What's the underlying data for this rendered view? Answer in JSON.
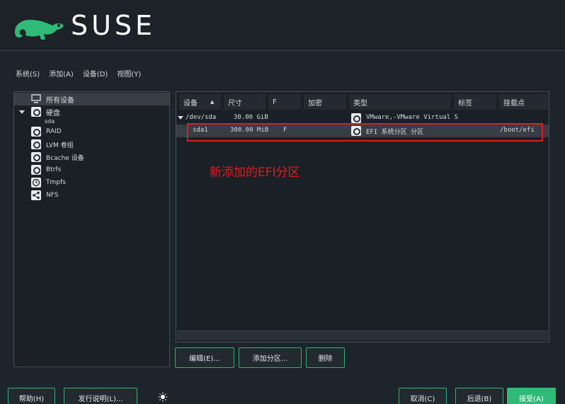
{
  "brand": {
    "name": "SUSE",
    "accent": "#30ba78",
    "annotation_color": "#e01b1b"
  },
  "menu": {
    "items": [
      "系统(S)",
      "添加(A)",
      "设备(D)",
      "视图(Y)"
    ]
  },
  "tree": {
    "items": [
      {
        "label": "所有设备",
        "icon": "monitor-icon",
        "selected": true
      },
      {
        "label": "硬盘",
        "icon": "hard-disk-icon",
        "expanded": true
      },
      {
        "label": "sda",
        "icon": ""
      },
      {
        "label": "RAID",
        "icon": "raid-icon"
      },
      {
        "label": "LVM 卷组",
        "icon": "lvm-icon"
      },
      {
        "label": "Bcache 设备",
        "icon": "bcache-icon"
      },
      {
        "label": "Btrfs",
        "icon": "btrfs-icon"
      },
      {
        "label": "Tmpfs",
        "icon": "clock-icon"
      },
      {
        "label": "NFS",
        "icon": "share-icon"
      }
    ]
  },
  "table": {
    "headers": [
      "设备",
      "尺寸",
      "F",
      "加密",
      "类型",
      "标签",
      "挂载点"
    ],
    "sort_indicator": "▲",
    "rows": [
      {
        "device": "/dev/sda",
        "size": "30.00 GiB",
        "f": "",
        "enc": "",
        "type": "VMware,-VMware Virtual S",
        "label": "",
        "mount": "",
        "expanded": true
      },
      {
        "device": "sda1",
        "size": "300.00 MiB",
        "f": "F",
        "enc": "",
        "type": "EFI 系统分区 分区",
        "label": "",
        "mount": "/boot/efi",
        "selected": true
      }
    ]
  },
  "annotation": {
    "text": "新添加的EFI分区"
  },
  "actions": {
    "edit": "编辑(E)...",
    "add_partition": "添加分区...",
    "delete": "删除"
  },
  "footer": {
    "help": "帮助(H)",
    "release_notes": "发行说明(L)...",
    "cancel": "取消(C)",
    "back": "后退(B)",
    "accept": "接受(A)"
  }
}
